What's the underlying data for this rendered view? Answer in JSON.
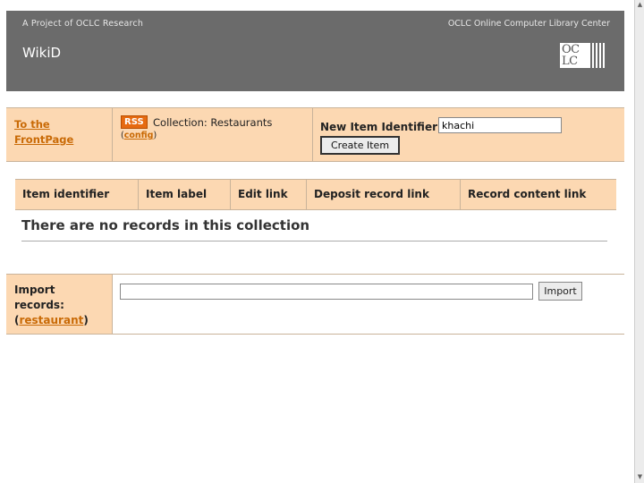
{
  "header": {
    "tagline_left": "A Project of OCLC Research",
    "tagline_right": "OCLC Online Computer Library Center",
    "app_title": "WikiD",
    "logo": "oclc-logo",
    "logo_text_top": "OC",
    "logo_text_bottom": "LC",
    "bg_color": "#6b6b6b"
  },
  "top_panel": {
    "frontpage_link": "To the FrontPage",
    "rss_label": "RSS",
    "collection_title": "Collection: Restaurants",
    "config_prefix": "(",
    "config_link": "config",
    "config_suffix": ")",
    "new_id_label": "New Item Identifier:",
    "new_id_value": "khachi",
    "create_button": "Create Item",
    "bg_color": "#fcd8b2"
  },
  "records_table": {
    "columns": [
      "Item identifier",
      "Item label",
      "Edit link",
      "Deposit record link",
      "Record content link"
    ],
    "empty_message": "There are no records in this collection"
  },
  "import_panel": {
    "label_line1": "Import",
    "label_line2": "records:",
    "label_open": "(",
    "label_link": "restaurant",
    "label_close": ")",
    "input_value": "",
    "button": "Import"
  },
  "scrollbar": {
    "up_icon": "▲",
    "down_icon": "▼"
  },
  "colors": {
    "link": "#c96a06",
    "rss": "#e66a10"
  }
}
